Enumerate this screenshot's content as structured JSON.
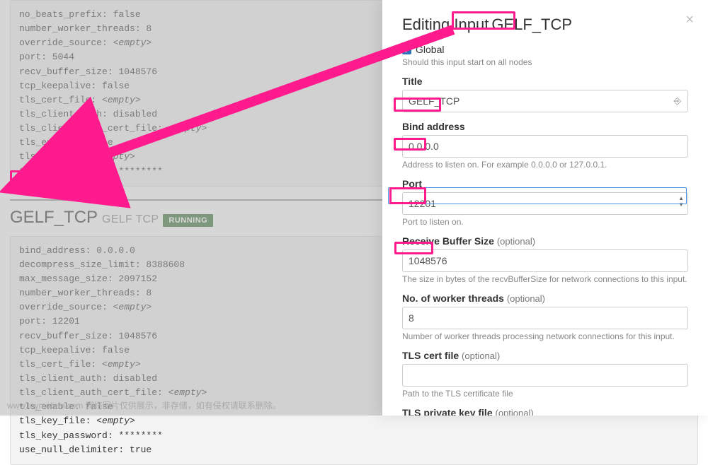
{
  "page": {
    "beats_config": [
      {
        "k": "no_beats_prefix",
        "v": "false"
      },
      {
        "k": "number_worker_threads",
        "v": "8"
      },
      {
        "k": "override_source",
        "v": "<empty>"
      },
      {
        "k": "port",
        "v": "5044"
      },
      {
        "k": "recv_buffer_size",
        "v": "1048576"
      },
      {
        "k": "tcp_keepalive",
        "v": "false"
      },
      {
        "k": "tls_cert_file",
        "v": "<empty>"
      },
      {
        "k": "tls_client_auth",
        "v": "disabled"
      },
      {
        "k": "tls_client_auth_cert_file",
        "v": "<empty>"
      },
      {
        "k": "tls_enable",
        "v": "false"
      },
      {
        "k": "tls_key_file",
        "v": "<empty>"
      },
      {
        "k": "tls_key_password",
        "v": "********"
      }
    ],
    "gelf_header": {
      "name": "GELF_TCP",
      "type": "GELF TCP",
      "status": "RUNNING"
    },
    "gelf_config": [
      {
        "k": "bind_address",
        "v": "0.0.0.0"
      },
      {
        "k": "decompress_size_limit",
        "v": "8388608"
      },
      {
        "k": "max_message_size",
        "v": "2097152"
      },
      {
        "k": "number_worker_threads",
        "v": "8"
      },
      {
        "k": "override_source",
        "v": "<empty>"
      },
      {
        "k": "port",
        "v": "12201"
      },
      {
        "k": "recv_buffer_size",
        "v": "1048576"
      },
      {
        "k": "tcp_keepalive",
        "v": "false"
      },
      {
        "k": "tls_cert_file",
        "v": "<empty>"
      },
      {
        "k": "tls_client_auth",
        "v": "disabled"
      },
      {
        "k": "tls_client_auth_cert_file",
        "v": "<empty>"
      },
      {
        "k": "tls_enable",
        "v": "false"
      },
      {
        "k": "tls_key_file",
        "v": "<empty>"
      },
      {
        "k": "tls_key_password",
        "v": "********"
      },
      {
        "k": "use_null_delimiter",
        "v": "true"
      }
    ]
  },
  "modal": {
    "title_prefix": "Editing Input ",
    "title_name": "GELF_TCP",
    "global_label": "Global",
    "global_checked": true,
    "global_help": "Should this input start on all nodes",
    "fields": {
      "title": {
        "label": "Title",
        "value": "GELF_TCP"
      },
      "bind": {
        "label": "Bind address",
        "value": "0.0.0.0",
        "help": "Address to listen on. For example 0.0.0.0 or 127.0.0.1."
      },
      "port": {
        "label": "Port",
        "value": "12201",
        "help": "Port to listen on."
      },
      "recv": {
        "label": "Receive Buffer Size",
        "optional": "(optional)",
        "value": "1048576",
        "help": "The size in bytes of the recvBufferSize for network connections to this input."
      },
      "workers": {
        "label": "No. of worker threads",
        "optional": "(optional)",
        "value": "8",
        "help": "Number of worker threads processing network connections for this input."
      },
      "tlscert": {
        "label": "TLS cert file",
        "optional": "(optional)",
        "value": "",
        "help": "Path to the TLS certificate file"
      },
      "tlskey": {
        "label": "TLS private key file",
        "optional": "(optional)",
        "value": ""
      }
    }
  },
  "footer": "www.toymoban.com  网络图片仅供展示，非存储，如有侵权请联系删除。"
}
